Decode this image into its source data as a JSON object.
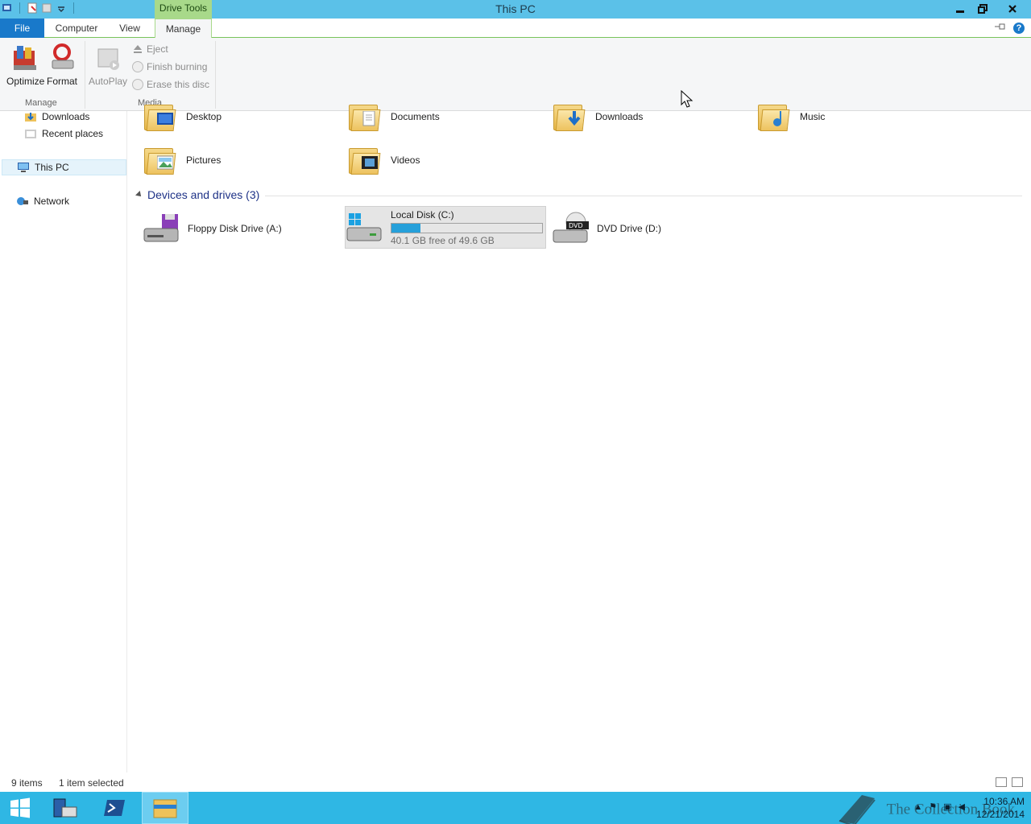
{
  "window": {
    "title": "This PC",
    "contextual_tab_group": "Drive Tools"
  },
  "ribbon": {
    "tabs": [
      {
        "label": "File"
      },
      {
        "label": "Computer"
      },
      {
        "label": "View"
      },
      {
        "label": "Manage"
      }
    ],
    "manage_group": {
      "label": "Manage",
      "buttons": [
        {
          "label": "Optimize"
        },
        {
          "label": "Format"
        }
      ]
    },
    "media_group": {
      "label": "Media",
      "autoplay": "AutoPlay",
      "eject": "Eject",
      "finish_burning": "Finish burning",
      "erase_disc": "Erase this disc"
    }
  },
  "navigation": {
    "items": [
      {
        "label": "Downloads",
        "icon": "downloads-icon"
      },
      {
        "label": "Recent places",
        "icon": "recent-places-icon"
      },
      {
        "label": "This PC",
        "icon": "computer-icon",
        "selected": true
      },
      {
        "label": "Network",
        "icon": "network-icon"
      }
    ]
  },
  "folders": [
    {
      "label": "Desktop",
      "icon": "desktop-folder-icon"
    },
    {
      "label": "Documents",
      "icon": "documents-folder-icon"
    },
    {
      "label": "Downloads",
      "icon": "downloads-folder-icon"
    },
    {
      "label": "Music",
      "icon": "music-folder-icon"
    },
    {
      "label": "Pictures",
      "icon": "pictures-folder-icon"
    },
    {
      "label": "Videos",
      "icon": "videos-folder-icon"
    }
  ],
  "devices_section": {
    "header": "Devices and drives (3)",
    "drives": [
      {
        "label": "Floppy Disk Drive (A:)",
        "icon": "floppy-drive-icon"
      },
      {
        "label": "Local Disk (C:)",
        "free_text": "40.1 GB free of 49.6 GB",
        "used_fraction": 0.19,
        "selected": true,
        "icon": "hard-disk-icon"
      },
      {
        "label": "DVD Drive (D:)",
        "icon": "dvd-drive-icon"
      }
    ]
  },
  "status": {
    "item_count": "9 items",
    "selection": "1 item selected"
  },
  "taskbar": {
    "time": "10:36 AM",
    "date": "12/21/2014",
    "watermark": "The Collection Book"
  },
  "colors": {
    "titlebar": "#5bc1e8",
    "file_tab": "#1979ca",
    "taskbar": "#2fb7e4",
    "contextual": "#a8d98a",
    "drive_fill": "#26a0da"
  }
}
